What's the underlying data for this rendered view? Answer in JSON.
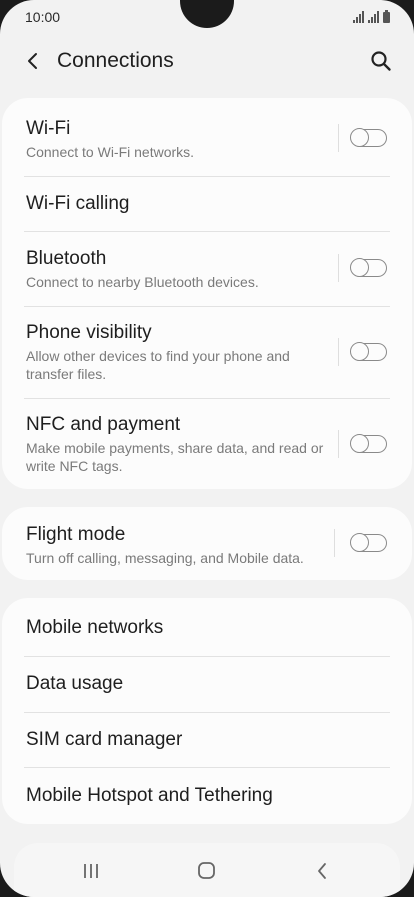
{
  "status_bar": {
    "time": "10:00"
  },
  "header": {
    "title": "Connections"
  },
  "groups": [
    {
      "items": [
        {
          "label": "Wi-Fi",
          "subtitle": "Connect to Wi-Fi networks.",
          "toggle": false
        },
        {
          "label": "Wi-Fi calling"
        },
        {
          "label": "Bluetooth",
          "subtitle": "Connect to nearby Bluetooth devices.",
          "toggle": false
        },
        {
          "label": "Phone visibility",
          "subtitle": "Allow other devices to find your phone and transfer files.",
          "toggle": false
        },
        {
          "label": "NFC and payment",
          "subtitle": "Make mobile payments, share data, and read or write NFC tags.",
          "toggle": false
        }
      ]
    },
    {
      "items": [
        {
          "label": "Flight mode",
          "subtitle": "Turn off calling, messaging, and Mobile data.",
          "toggle": false
        }
      ]
    },
    {
      "items": [
        {
          "label": "Mobile networks"
        },
        {
          "label": "Data usage"
        },
        {
          "label": "SIM card manager"
        },
        {
          "label": "Mobile Hotspot and Tethering"
        }
      ]
    }
  ]
}
